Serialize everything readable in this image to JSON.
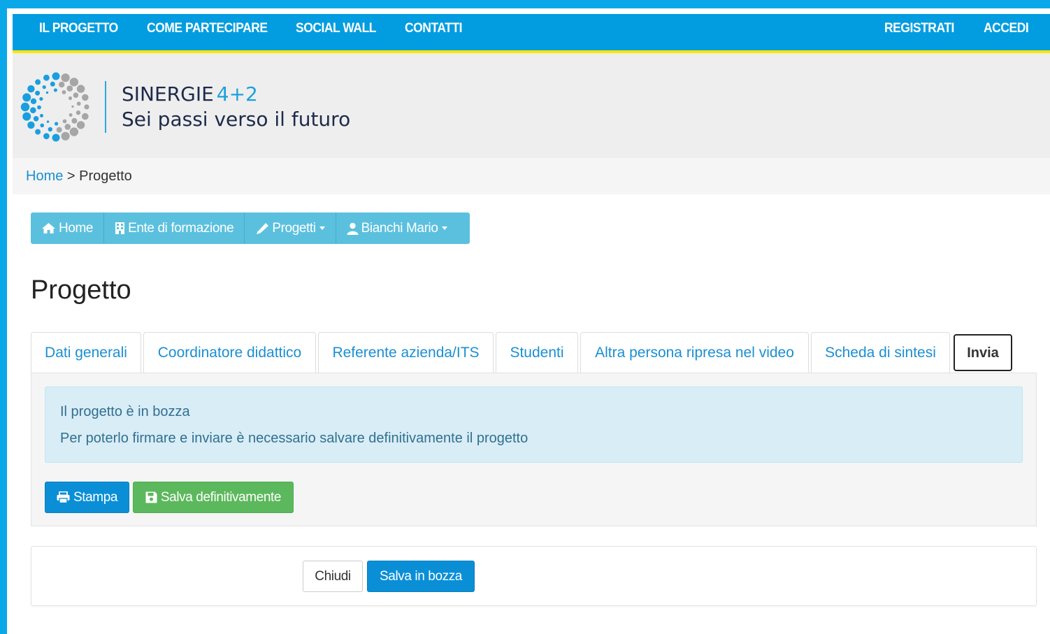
{
  "topnav": {
    "left_items": [
      "IL PROGETTO",
      "COME PARTECIPARE",
      "SOCIAL WALL",
      "CONTATTI"
    ],
    "right_items": [
      "REGISTRATI",
      "ACCEDI"
    ]
  },
  "brand": {
    "title": "SINERGIE",
    "version": "4+2",
    "subtitle": "Sei passi verso il futuro",
    "logo_icon": "dotted-circle-logo"
  },
  "breadcrumb": {
    "home": "Home",
    "separator": " > ",
    "current": "Progetto"
  },
  "subnav": {
    "items": [
      {
        "label": "Home",
        "icon": "home-icon"
      },
      {
        "label": "Ente di formazione",
        "icon": "building-icon"
      },
      {
        "label": "Progetti",
        "icon": "pencil-icon",
        "dropdown": true
      },
      {
        "label": "Bianchi Mario",
        "icon": "user-icon",
        "dropdown": true
      }
    ]
  },
  "page": {
    "title": "Progetto"
  },
  "tabs": [
    {
      "label": "Dati generali"
    },
    {
      "label": "Coordinatore didattico"
    },
    {
      "label": "Referente azienda/ITS"
    },
    {
      "label": "Studenti"
    },
    {
      "label": "Altra persona ripresa nel video"
    },
    {
      "label": "Scheda di sintesi"
    },
    {
      "label": "Invia",
      "active": true
    }
  ],
  "alert": {
    "line1": "Il progetto è in bozza",
    "line2": "Per poterlo firmare e inviare è necessario salvare definitivamente il progetto"
  },
  "actions": {
    "print": "Stampa",
    "save_final": "Salva definitivamente"
  },
  "footer": {
    "close": "Chiudi",
    "save_draft": "Salva in bozza"
  },
  "colors": {
    "nav_blue": "#029de0",
    "accent_yellow": "#ffe600",
    "info_bg": "#d9edf7",
    "success": "#5cb85c",
    "primary": "#0a8fd6"
  }
}
